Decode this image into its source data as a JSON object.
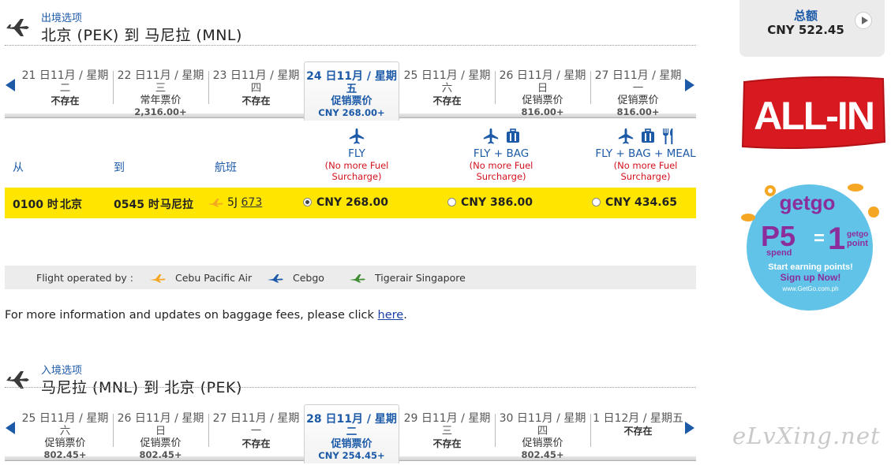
{
  "outbound": {
    "label": "出境选项",
    "route": "北京 (PEK) 到 马尼拉 (MNL)",
    "dates": [
      {
        "line1": "21 日11月 / 星期",
        "line2": "二",
        "line3": "不存在",
        "line4": "",
        "none": true,
        "active": false
      },
      {
        "line1": "22 日11月 / 星期",
        "line2": "三",
        "line3": "常年票价",
        "line4": "2,316.00+",
        "none": false,
        "active": false
      },
      {
        "line1": "23 日11月 / 星期",
        "line2": "四",
        "line3": "不存在",
        "line4": "",
        "none": true,
        "active": false
      },
      {
        "line1": "24 日11月 / 星期",
        "line2": "五",
        "line3": "促销票价",
        "line4": "CNY 268.00+",
        "none": false,
        "active": true
      },
      {
        "line1": "25 日11月 / 星期",
        "line2": "六",
        "line3": "不存在",
        "line4": "",
        "none": true,
        "active": false
      },
      {
        "line1": "26 日11月 / 星期",
        "line2": "日",
        "line3": "促销票价",
        "line4": "816.00+",
        "none": false,
        "active": false
      },
      {
        "line1": "27 日11月 / 星期",
        "line2": "一",
        "line3": "促销票价",
        "line4": "816.00+",
        "none": false,
        "active": false
      }
    ],
    "columns": {
      "from": "从",
      "to": "到",
      "flight": "航班"
    },
    "fares": [
      {
        "name": "FLY",
        "note1": "(No more Fuel",
        "note2": "Surcharge)"
      },
      {
        "name": "FLY + BAG",
        "note1": "(No more Fuel",
        "note2": "Surcharge)"
      },
      {
        "name": "FLY + BAG + MEAL",
        "note1": "(No more Fuel",
        "note2": "Surcharge)"
      }
    ],
    "flight": {
      "depart_time": "0100 时",
      "depart_city": "北京",
      "arrive_time": "0545 时",
      "arrive_city": "马尼拉",
      "airline_code": "5J",
      "flight_no": "673",
      "price_fly": "CNY 268.00",
      "price_bag": "CNY 386.00",
      "price_meal": "CNY 434.65",
      "selected": "fly"
    }
  },
  "operated_by": {
    "label": "Flight operated by :",
    "carriers": [
      {
        "name": "Cebu Pacific Air",
        "color": "#f5a623"
      },
      {
        "name": "Cebgo",
        "color": "#1c5aa8"
      },
      {
        "name": "Tigerair Singapore",
        "color": "#3d8b2f"
      }
    ]
  },
  "baggage_text": "For more information and updates on baggage fees, please click",
  "baggage_link": "here",
  "baggage_end": ".",
  "inbound": {
    "label": "入境选项",
    "route": "马尼拉 (MNL) 到 北京 (PEK)",
    "dates": [
      {
        "line1": "25 日11月 / 星期",
        "line2": "六",
        "line3": "促销票价",
        "line4": "802.45+",
        "none": false,
        "active": false
      },
      {
        "line1": "26 日11月 / 星期",
        "line2": "日",
        "line3": "促销票价",
        "line4": "802.45+",
        "none": false,
        "active": false
      },
      {
        "line1": "27 日11月 / 星期",
        "line2": "一",
        "line3": "不存在",
        "line4": "",
        "none": true,
        "active": false
      },
      {
        "line1": "28 日11月 / 星期",
        "line2": "二",
        "line3": "促销票价",
        "line4": "CNY 254.45+",
        "none": false,
        "active": true
      },
      {
        "line1": "29 日11月 / 星期",
        "line2": "三",
        "line3": "不存在",
        "line4": "",
        "none": true,
        "active": false
      },
      {
        "line1": "30 日11月 / 星期",
        "line2": "四",
        "line3": "促销票价",
        "line4": "802.45+",
        "none": false,
        "active": false
      },
      {
        "line1": "1 日12月 / 星期五",
        "line2": "",
        "line3": "不存在",
        "line4": "",
        "none": true,
        "active": false
      }
    ]
  },
  "total": {
    "label": "总额",
    "value": "CNY  522.45"
  },
  "ads": {
    "allin": "ALL-IN",
    "getgo": {
      "brand": "getgo",
      "big": "P5",
      "spend": "spend",
      "equals": "=",
      "one": "1",
      "point1": "getgo",
      "point2": "point",
      "line1": "Start earning points!",
      "line2": "Sign up Now!",
      "url": "www.GetGo.com.ph"
    }
  },
  "watermark": "eLvXing.net",
  "colors": {
    "accent": "#1c5aa8",
    "highlight": "#ffe600",
    "red": "#d4121e"
  }
}
